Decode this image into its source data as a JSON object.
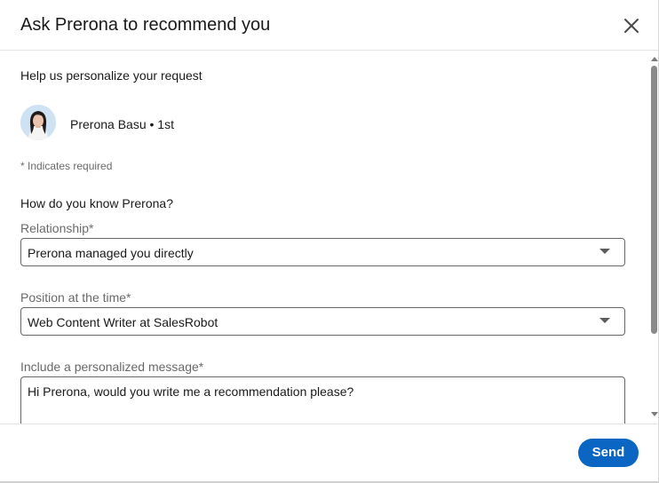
{
  "dialog": {
    "title": "Ask Prerona to recommend you",
    "close_icon": "close-icon"
  },
  "form": {
    "subtitle": "Help us personalize your request",
    "person": {
      "name": "Prerona Basu • 1st",
      "avatar_icon": "profile-photo"
    },
    "required_note": "* Indicates required",
    "question": "How do you know Prerona?",
    "relationship": {
      "label": "Relationship*",
      "value": "Prerona managed you directly"
    },
    "position": {
      "label": "Position at the time*",
      "value": "Web Content Writer at SalesRobot"
    },
    "message": {
      "label": "Include a personalized message*",
      "value": "Hi Prerona, would you write me a recommendation please?"
    }
  },
  "footer": {
    "send_label": "Send"
  },
  "colors": {
    "primary": "#0a66c2",
    "border": "#666666",
    "divider": "#e3e3e3",
    "avatar_bg": "#c9def2"
  }
}
